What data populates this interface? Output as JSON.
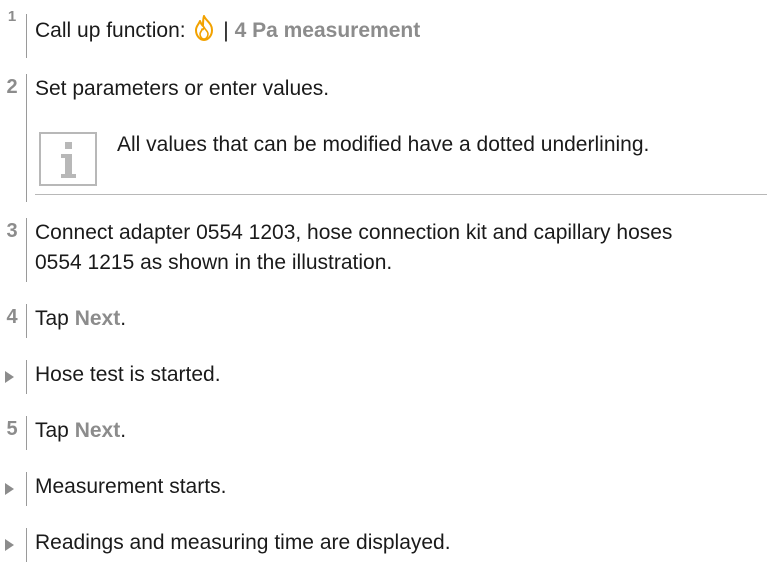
{
  "steps": [
    {
      "number": "1",
      "lead": "Call up function: ",
      "separator": "|",
      "keyword": "4 Pa measurement"
    },
    {
      "number": "2",
      "text": "Set parameters or enter values."
    },
    {
      "number": "3",
      "line1": "Connect adapter 0554 1203, hose connection kit and capillary hoses",
      "line2": "0554 1215 as shown in the illustration."
    },
    {
      "number": "4",
      "lead": "Tap ",
      "keyword": "Next",
      "trail": "."
    },
    {
      "number": "5",
      "lead": "Tap ",
      "keyword": "Next",
      "trail": "."
    }
  ],
  "note": {
    "text": "All values that can be modified have a dotted underlining.",
    "icon": "info-i-icon"
  },
  "results": [
    "Hose test is started.",
    "Measurement starts.",
    "Readings and measuring time are displayed."
  ],
  "icons": {
    "function_icon": "flame-icon",
    "result_marker": "triangle-arrow-icon"
  },
  "colors": {
    "text": "#1a1a1a",
    "step_number": "#8c8c8c",
    "keyword": "#8c8c8c",
    "flame": "#f2a200",
    "rule": "#9a9a9a"
  }
}
